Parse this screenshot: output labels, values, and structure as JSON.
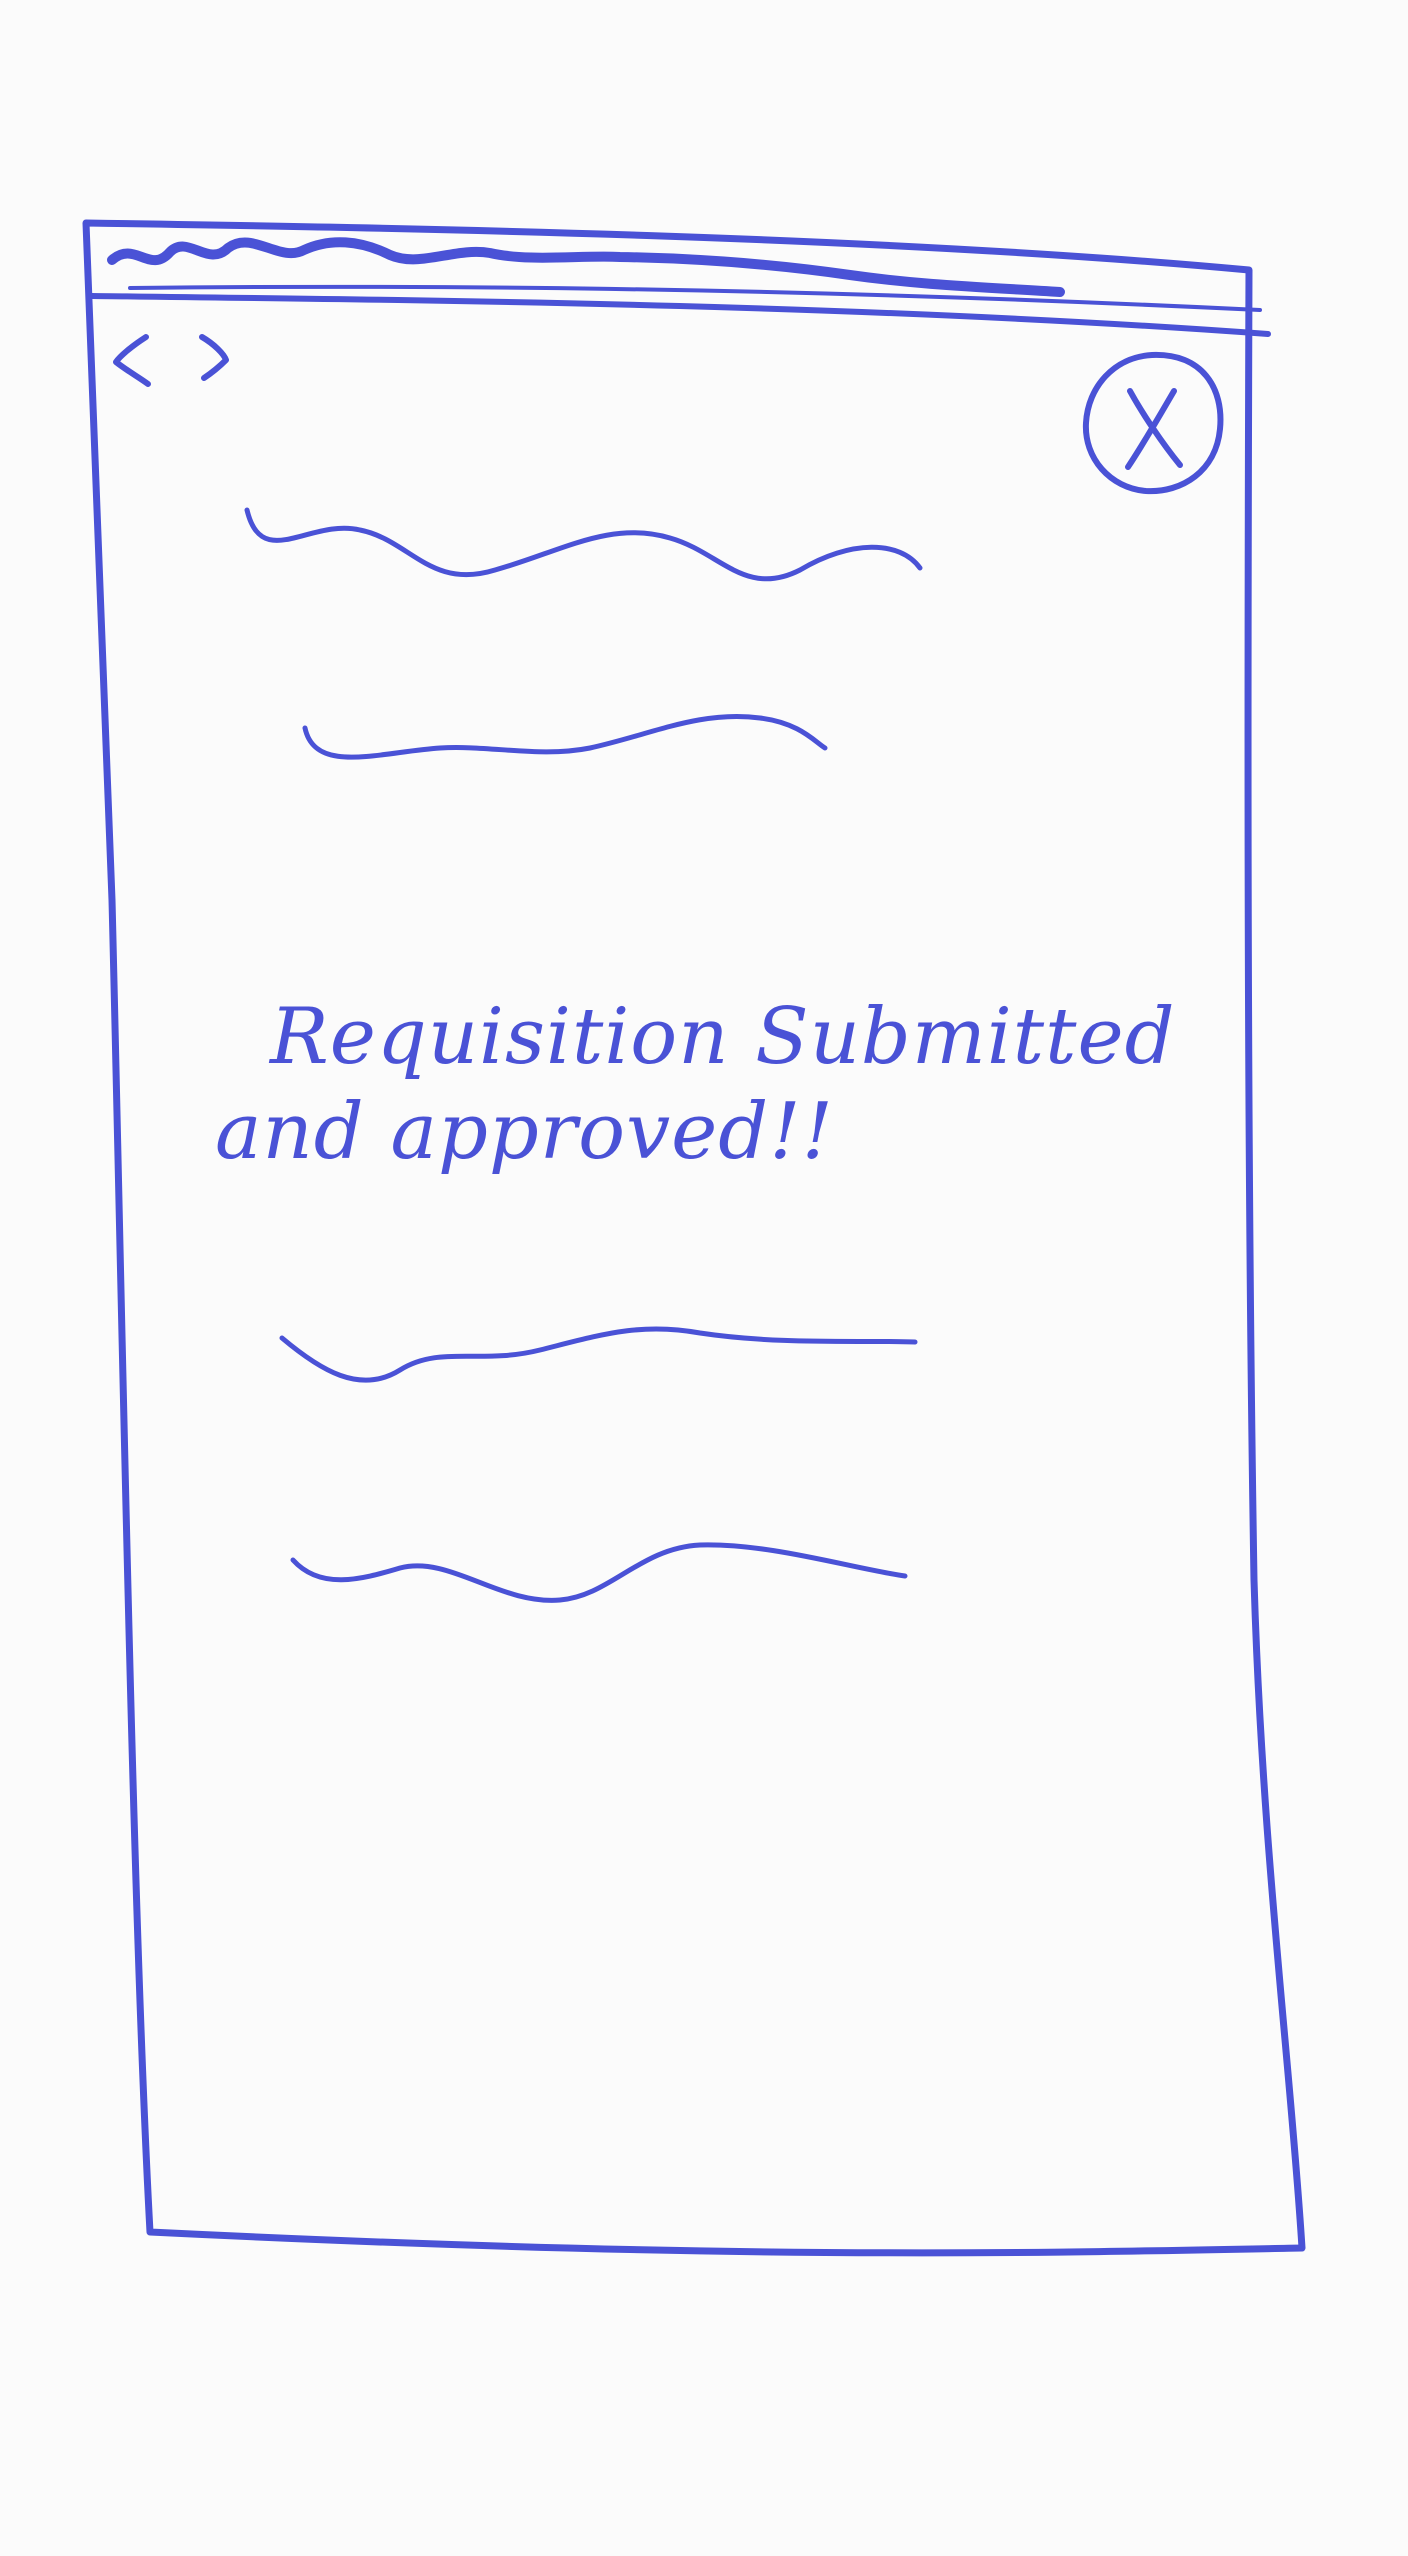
{
  "colors": {
    "ink": "#4a52d6",
    "paper": "#fbfbfb"
  },
  "browser": {
    "back_icon": "chevron-left-icon",
    "forward_icon": "chevron-right-icon",
    "close_icon": "close-circle-icon"
  },
  "message": {
    "line1": "Requisition Submitted",
    "line2": "and approved!!"
  }
}
